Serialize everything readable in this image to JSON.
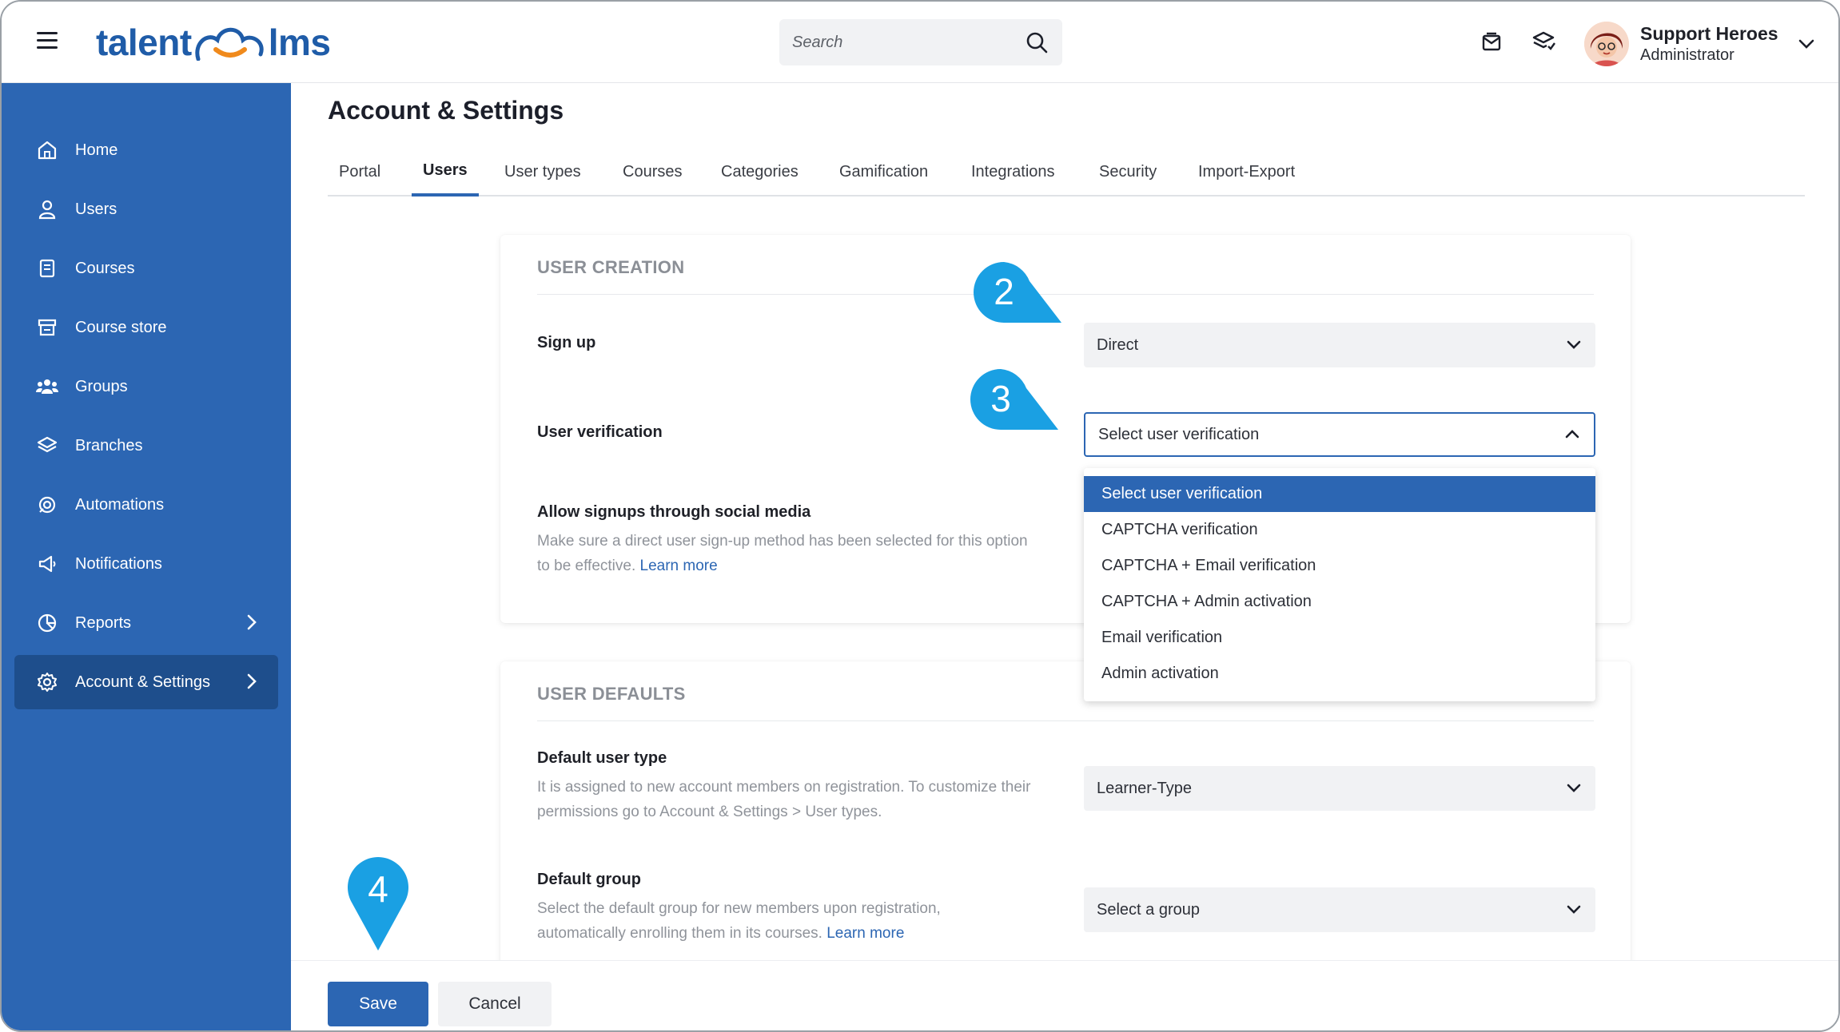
{
  "brand": {
    "part1": "talent",
    "part2": "lms"
  },
  "search": {
    "placeholder": "Search"
  },
  "user": {
    "name": "Support Heroes",
    "role": "Administrator"
  },
  "sidebar": {
    "items": [
      {
        "label": "Home",
        "icon": "home-icon"
      },
      {
        "label": "Users",
        "icon": "user-icon"
      },
      {
        "label": "Courses",
        "icon": "book-icon"
      },
      {
        "label": "Course store",
        "icon": "store-icon"
      },
      {
        "label": "Groups",
        "icon": "groups-icon"
      },
      {
        "label": "Branches",
        "icon": "layers-icon"
      },
      {
        "label": "Automations",
        "icon": "automation-icon"
      },
      {
        "label": "Notifications",
        "icon": "megaphone-icon"
      },
      {
        "label": "Reports",
        "icon": "pie-chart-icon"
      },
      {
        "label": "Account & Settings",
        "icon": "gear-icon",
        "active": true
      }
    ]
  },
  "page": {
    "title": "Account & Settings"
  },
  "tabs": [
    "Portal",
    "Users",
    "User types",
    "Courses",
    "Categories",
    "Gamification",
    "Integrations",
    "Security",
    "Import-Export"
  ],
  "active_tab": "Users",
  "user_creation": {
    "title": "USER CREATION",
    "signup": {
      "label": "Sign up",
      "value": "Direct"
    },
    "verification": {
      "label": "User verification",
      "value": "Select user verification",
      "options": [
        "Select user verification",
        "CAPTCHA verification",
        "CAPTCHA + Email verification",
        "CAPTCHA + Admin activation",
        "Email verification",
        "Admin activation"
      ]
    },
    "social": {
      "label": "Allow signups through social media",
      "help": "Make sure a direct user sign-up method has been selected for this option to be effective.",
      "link": "Learn more"
    }
  },
  "user_defaults": {
    "title": "USER DEFAULTS",
    "user_type": {
      "label": "Default user type",
      "help": "It is assigned to new account members on registration. To customize their permissions go to Account & Settings > User types.",
      "value": "Learner-Type"
    },
    "group": {
      "label": "Default group",
      "help": "Select the default group for new members upon registration, automatically enrolling them in its courses.",
      "link": "Learn more",
      "value": "Select a group"
    }
  },
  "markers": [
    "2",
    "3",
    "4"
  ],
  "footer": {
    "save": "Save",
    "cancel": "Cancel"
  },
  "colors": {
    "primary": "#2c66b3",
    "sidebar": "#2c66b3",
    "marker": "#1aa0e3",
    "logo_orange": "#f08a1c"
  }
}
